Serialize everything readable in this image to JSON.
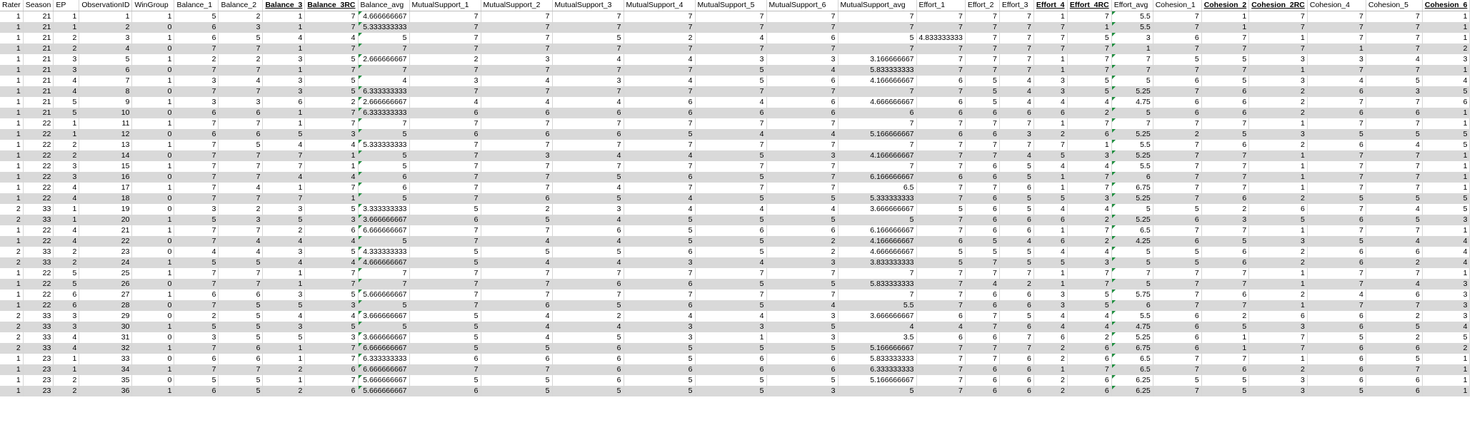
{
  "columns": [
    {
      "label": "Rater",
      "bold": false
    },
    {
      "label": "Season",
      "bold": false
    },
    {
      "label": "EP",
      "bold": false
    },
    {
      "label": "ObservationID",
      "bold": false
    },
    {
      "label": "WinGroup",
      "bold": false
    },
    {
      "label": "Balance_1",
      "bold": false
    },
    {
      "label": "Balance_2",
      "bold": false
    },
    {
      "label": "Balance_3",
      "bold": true
    },
    {
      "label": "Balance_3RC",
      "bold": true
    },
    {
      "label": "Balance_avg",
      "bold": false
    },
    {
      "label": "MutualSupport_1",
      "bold": false
    },
    {
      "label": "MutualSupport_2",
      "bold": false
    },
    {
      "label": "MutualSupport_3",
      "bold": false
    },
    {
      "label": "MutualSupport_4",
      "bold": false
    },
    {
      "label": "MutualSupport_5",
      "bold": false
    },
    {
      "label": "MutualSupport_6",
      "bold": false
    },
    {
      "label": "MutualSupport_avg",
      "bold": false
    },
    {
      "label": "Effort_1",
      "bold": false
    },
    {
      "label": "Effort_2",
      "bold": false
    },
    {
      "label": "Effort_3",
      "bold": false
    },
    {
      "label": "Effort_4",
      "bold": true
    },
    {
      "label": "Effort_4RC",
      "bold": true
    },
    {
      "label": "Effort_avg",
      "bold": false
    },
    {
      "label": "Cohesion_1",
      "bold": false
    },
    {
      "label": "Cohesion_2",
      "bold": true
    },
    {
      "label": "Cohesion_2RC",
      "bold": true
    },
    {
      "label": "Cohesion_4",
      "bold": false
    },
    {
      "label": "Cohesion_5",
      "bold": false
    },
    {
      "label": "Cohesion_6",
      "bold": true
    }
  ],
  "flag_columns": [
    9,
    22
  ],
  "rows": [
    [
      "1",
      "21",
      "1",
      "1",
      "1",
      "5",
      "2",
      "1",
      "7",
      "4.666666667",
      "7",
      "7",
      "7",
      "7",
      "7",
      "7",
      "7",
      "7",
      "7",
      "7",
      "1",
      "7",
      "5.5",
      "7",
      "1",
      "7",
      "7",
      "7",
      "1"
    ],
    [
      "1",
      "21",
      "1",
      "2",
      "0",
      "6",
      "3",
      "1",
      "7",
      "5.333333333",
      "7",
      "7",
      "7",
      "7",
      "7",
      "7",
      "7",
      "7",
      "7",
      "7",
      "7",
      "1",
      "5.5",
      "7",
      "1",
      "7",
      "7",
      "7",
      "1"
    ],
    [
      "1",
      "21",
      "2",
      "3",
      "1",
      "6",
      "5",
      "4",
      "4",
      "5",
      "7",
      "7",
      "5",
      "2",
      "4",
      "6",
      "5",
      "4.833333333",
      "7",
      "7",
      "7",
      "5",
      "3",
      "6",
      "7",
      "1",
      "7",
      "7",
      "1"
    ],
    [
      "1",
      "21",
      "2",
      "4",
      "0",
      "7",
      "7",
      "1",
      "7",
      "7",
      "7",
      "7",
      "7",
      "7",
      "7",
      "7",
      "7",
      "7",
      "7",
      "7",
      "7",
      "7",
      "1",
      "7",
      "7",
      "7",
      "1",
      "7",
      "2"
    ],
    [
      "1",
      "21",
      "3",
      "5",
      "1",
      "2",
      "2",
      "3",
      "5",
      "2.666666667",
      "2",
      "3",
      "4",
      "4",
      "3",
      "3",
      "3.166666667",
      "7",
      "7",
      "7",
      "1",
      "7",
      "7",
      "5",
      "5",
      "3",
      "3",
      "4",
      "3"
    ],
    [
      "1",
      "21",
      "3",
      "6",
      "0",
      "7",
      "7",
      "1",
      "7",
      "7",
      "7",
      "7",
      "7",
      "7",
      "5",
      "4",
      "5.833333333",
      "7",
      "7",
      "7",
      "1",
      "7",
      "7",
      "7",
      "7",
      "1",
      "7",
      "7",
      "1"
    ],
    [
      "1",
      "21",
      "4",
      "7",
      "1",
      "3",
      "4",
      "3",
      "5",
      "4",
      "3",
      "4",
      "3",
      "4",
      "5",
      "6",
      "4.166666667",
      "6",
      "5",
      "4",
      "3",
      "5",
      "5",
      "6",
      "5",
      "3",
      "4",
      "5",
      "4"
    ],
    [
      "1",
      "21",
      "4",
      "8",
      "0",
      "7",
      "7",
      "3",
      "5",
      "6.333333333",
      "7",
      "7",
      "7",
      "7",
      "7",
      "7",
      "7",
      "7",
      "5",
      "4",
      "3",
      "5",
      "5.25",
      "7",
      "6",
      "2",
      "6",
      "3",
      "5"
    ],
    [
      "1",
      "21",
      "5",
      "9",
      "1",
      "3",
      "3",
      "6",
      "2",
      "2.666666667",
      "4",
      "4",
      "4",
      "6",
      "4",
      "6",
      "4.666666667",
      "6",
      "5",
      "4",
      "4",
      "4",
      "4.75",
      "6",
      "6",
      "2",
      "7",
      "7",
      "6"
    ],
    [
      "1",
      "21",
      "5",
      "10",
      "0",
      "6",
      "6",
      "1",
      "7",
      "6.333333333",
      "6",
      "6",
      "6",
      "6",
      "6",
      "6",
      "6",
      "6",
      "6",
      "6",
      "6",
      "2",
      "5",
      "6",
      "6",
      "2",
      "6",
      "6",
      "1"
    ],
    [
      "1",
      "22",
      "1",
      "11",
      "1",
      "7",
      "7",
      "1",
      "7",
      "7",
      "7",
      "7",
      "7",
      "7",
      "7",
      "7",
      "7",
      "7",
      "7",
      "7",
      "1",
      "7",
      "7",
      "7",
      "7",
      "1",
      "7",
      "7",
      "1"
    ],
    [
      "1",
      "22",
      "1",
      "12",
      "0",
      "6",
      "6",
      "5",
      "3",
      "5",
      "6",
      "6",
      "6",
      "5",
      "4",
      "4",
      "5.166666667",
      "6",
      "6",
      "3",
      "2",
      "6",
      "5.25",
      "2",
      "5",
      "3",
      "5",
      "5",
      "5"
    ],
    [
      "1",
      "22",
      "2",
      "13",
      "1",
      "7",
      "5",
      "4",
      "4",
      "5.333333333",
      "7",
      "7",
      "7",
      "7",
      "7",
      "7",
      "7",
      "7",
      "7",
      "7",
      "7",
      "1",
      "5.5",
      "7",
      "6",
      "2",
      "6",
      "4",
      "5"
    ],
    [
      "1",
      "22",
      "2",
      "14",
      "0",
      "7",
      "7",
      "7",
      "1",
      "5",
      "7",
      "3",
      "4",
      "4",
      "5",
      "3",
      "4.166666667",
      "7",
      "7",
      "4",
      "5",
      "3",
      "5.25",
      "7",
      "7",
      "1",
      "7",
      "7",
      "1"
    ],
    [
      "1",
      "22",
      "3",
      "15",
      "1",
      "7",
      "7",
      "7",
      "1",
      "5",
      "7",
      "7",
      "7",
      "7",
      "7",
      "7",
      "7",
      "7",
      "6",
      "5",
      "4",
      "4",
      "5.5",
      "7",
      "7",
      "1",
      "7",
      "7",
      "1"
    ],
    [
      "1",
      "22",
      "3",
      "16",
      "0",
      "7",
      "7",
      "4",
      "4",
      "6",
      "7",
      "7",
      "5",
      "6",
      "5",
      "7",
      "6.166666667",
      "6",
      "6",
      "5",
      "1",
      "7",
      "6",
      "7",
      "7",
      "1",
      "7",
      "7",
      "1"
    ],
    [
      "1",
      "22",
      "4",
      "17",
      "1",
      "7",
      "4",
      "1",
      "7",
      "6",
      "7",
      "7",
      "4",
      "7",
      "7",
      "7",
      "6.5",
      "7",
      "7",
      "6",
      "1",
      "7",
      "6.75",
      "7",
      "7",
      "1",
      "7",
      "7",
      "1"
    ],
    [
      "1",
      "22",
      "4",
      "18",
      "0",
      "7",
      "7",
      "7",
      "1",
      "5",
      "7",
      "6",
      "5",
      "4",
      "5",
      "5",
      "5.333333333",
      "7",
      "6",
      "5",
      "5",
      "3",
      "5.25",
      "7",
      "6",
      "2",
      "5",
      "5",
      "5"
    ],
    [
      "2",
      "33",
      "1",
      "19",
      "0",
      "3",
      "2",
      "3",
      "5",
      "3.333333333",
      "5",
      "2",
      "3",
      "4",
      "4",
      "4",
      "3.666666667",
      "5",
      "6",
      "5",
      "4",
      "4",
      "5",
      "5",
      "2",
      "6",
      "7",
      "4",
      "5"
    ],
    [
      "2",
      "33",
      "1",
      "20",
      "1",
      "5",
      "3",
      "5",
      "3",
      "3.666666667",
      "6",
      "5",
      "4",
      "5",
      "5",
      "5",
      "5",
      "7",
      "6",
      "6",
      "6",
      "2",
      "5.25",
      "6",
      "3",
      "5",
      "6",
      "5",
      "3"
    ],
    [
      "1",
      "22",
      "4",
      "21",
      "1",
      "7",
      "7",
      "2",
      "6",
      "6.666666667",
      "7",
      "7",
      "6",
      "5",
      "6",
      "6",
      "6.166666667",
      "7",
      "6",
      "6",
      "1",
      "7",
      "6.5",
      "7",
      "7",
      "1",
      "7",
      "7",
      "1"
    ],
    [
      "1",
      "22",
      "4",
      "22",
      "0",
      "7",
      "4",
      "4",
      "4",
      "5",
      "7",
      "4",
      "4",
      "5",
      "5",
      "2",
      "4.166666667",
      "6",
      "5",
      "4",
      "6",
      "2",
      "4.25",
      "6",
      "5",
      "3",
      "5",
      "4",
      "4"
    ],
    [
      "2",
      "33",
      "2",
      "23",
      "0",
      "4",
      "4",
      "3",
      "5",
      "4.333333333",
      "5",
      "5",
      "5",
      "6",
      "5",
      "2",
      "4.666666667",
      "5",
      "5",
      "5",
      "4",
      "4",
      "5",
      "5",
      "6",
      "2",
      "6",
      "6",
      "4"
    ],
    [
      "2",
      "33",
      "2",
      "24",
      "1",
      "5",
      "5",
      "4",
      "4",
      "4.666666667",
      "5",
      "4",
      "4",
      "3",
      "4",
      "3",
      "3.833333333",
      "5",
      "7",
      "5",
      "5",
      "3",
      "5",
      "5",
      "6",
      "2",
      "6",
      "2",
      "4"
    ],
    [
      "1",
      "22",
      "5",
      "25",
      "1",
      "7",
      "7",
      "1",
      "7",
      "7",
      "7",
      "7",
      "7",
      "7",
      "7",
      "7",
      "7",
      "7",
      "7",
      "7",
      "1",
      "7",
      "7",
      "7",
      "7",
      "1",
      "7",
      "7",
      "1"
    ],
    [
      "1",
      "22",
      "5",
      "26",
      "0",
      "7",
      "7",
      "1",
      "7",
      "7",
      "7",
      "7",
      "6",
      "6",
      "5",
      "5",
      "5.833333333",
      "7",
      "4",
      "2",
      "1",
      "7",
      "5",
      "7",
      "7",
      "1",
      "7",
      "4",
      "3"
    ],
    [
      "1",
      "22",
      "6",
      "27",
      "1",
      "6",
      "6",
      "3",
      "5",
      "5.666666667",
      "7",
      "7",
      "7",
      "7",
      "7",
      "7",
      "7",
      "7",
      "6",
      "6",
      "3",
      "5",
      "5.75",
      "7",
      "6",
      "2",
      "4",
      "6",
      "3"
    ],
    [
      "1",
      "22",
      "6",
      "28",
      "0",
      "7",
      "5",
      "5",
      "3",
      "5",
      "7",
      "6",
      "5",
      "6",
      "5",
      "4",
      "5.5",
      "7",
      "6",
      "6",
      "3",
      "5",
      "6",
      "7",
      "7",
      "1",
      "7",
      "7",
      "3"
    ],
    [
      "2",
      "33",
      "3",
      "29",
      "0",
      "2",
      "5",
      "4",
      "4",
      "3.666666667",
      "5",
      "4",
      "2",
      "4",
      "4",
      "3",
      "3.666666667",
      "6",
      "7",
      "5",
      "4",
      "4",
      "5.5",
      "6",
      "2",
      "6",
      "6",
      "2",
      "3"
    ],
    [
      "2",
      "33",
      "3",
      "30",
      "1",
      "5",
      "5",
      "3",
      "5",
      "5",
      "5",
      "4",
      "4",
      "3",
      "3",
      "5",
      "4",
      "4",
      "7",
      "6",
      "4",
      "4",
      "4.75",
      "6",
      "5",
      "3",
      "6",
      "5",
      "4"
    ],
    [
      "2",
      "33",
      "4",
      "31",
      "0",
      "3",
      "5",
      "5",
      "3",
      "3.666666667",
      "5",
      "4",
      "5",
      "3",
      "1",
      "3",
      "3.5",
      "6",
      "6",
      "7",
      "6",
      "2",
      "5.25",
      "6",
      "1",
      "7",
      "5",
      "2",
      "5"
    ],
    [
      "2",
      "33",
      "4",
      "32",
      "1",
      "7",
      "6",
      "1",
      "7",
      "6.666666667",
      "5",
      "5",
      "6",
      "5",
      "5",
      "5",
      "5.166666667",
      "7",
      "7",
      "7",
      "2",
      "6",
      "6.75",
      "6",
      "1",
      "7",
      "6",
      "6",
      "2"
    ],
    [
      "1",
      "23",
      "1",
      "33",
      "0",
      "6",
      "6",
      "1",
      "7",
      "6.333333333",
      "6",
      "6",
      "6",
      "5",
      "6",
      "6",
      "5.833333333",
      "7",
      "7",
      "6",
      "2",
      "6",
      "6.5",
      "7",
      "7",
      "1",
      "6",
      "5",
      "1"
    ],
    [
      "1",
      "23",
      "1",
      "34",
      "1",
      "7",
      "7",
      "2",
      "6",
      "6.666666667",
      "7",
      "7",
      "6",
      "6",
      "6",
      "6",
      "6.333333333",
      "7",
      "6",
      "6",
      "1",
      "7",
      "6.5",
      "7",
      "6",
      "2",
      "6",
      "7",
      "1"
    ],
    [
      "1",
      "23",
      "2",
      "35",
      "0",
      "5",
      "5",
      "1",
      "7",
      "5.666666667",
      "5",
      "5",
      "6",
      "5",
      "5",
      "5",
      "5.166666667",
      "7",
      "6",
      "6",
      "2",
      "6",
      "6.25",
      "5",
      "5",
      "3",
      "6",
      "6",
      "1"
    ],
    [
      "1",
      "23",
      "2",
      "36",
      "1",
      "6",
      "5",
      "2",
      "6",
      "5.666666667",
      "6",
      "5",
      "5",
      "5",
      "5",
      "3",
      "5",
      "7",
      "6",
      "6",
      "2",
      "6",
      "6.25",
      "7",
      "5",
      "3",
      "5",
      "6",
      "1"
    ]
  ]
}
